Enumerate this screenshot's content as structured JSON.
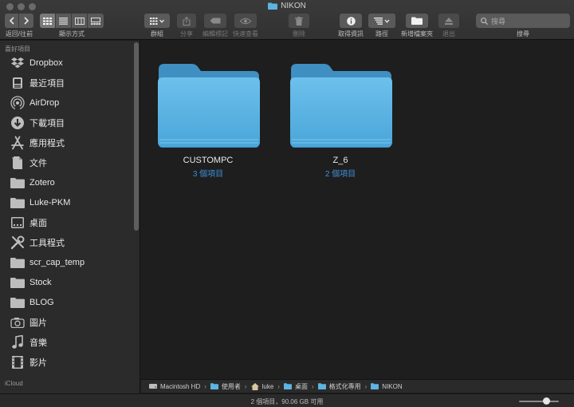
{
  "window": {
    "title": "NIKON"
  },
  "toolbar": {
    "nav_label": "返回/往前",
    "view_label": "顯示方式",
    "group_label": "群組",
    "share_label": "分享",
    "tags_label": "編輯標記",
    "quicklook_label": "快速查看",
    "delete_label": "刪除",
    "info_label": "取得資訊",
    "path_label": "路徑",
    "new_folder_label": "新增檔案夾",
    "eject_label": "退出",
    "search_label": "搜尋",
    "search_placeholder": "搜尋"
  },
  "sidebar": {
    "favorites_header": "喜好項目",
    "items": [
      {
        "label": "Dropbox",
        "icon": "dropbox-icon"
      },
      {
        "label": "最近項目",
        "icon": "recents-icon"
      },
      {
        "label": "AirDrop",
        "icon": "airdrop-icon"
      },
      {
        "label": "下載項目",
        "icon": "downloads-icon"
      },
      {
        "label": "應用程式",
        "icon": "applications-icon"
      },
      {
        "label": "文件",
        "icon": "documents-icon"
      },
      {
        "label": "Zotero",
        "icon": "folder-icon"
      },
      {
        "label": "Luke-PKM",
        "icon": "folder-icon"
      },
      {
        "label": "桌面",
        "icon": "desktop-icon"
      },
      {
        "label": "工具程式",
        "icon": "utilities-icon"
      },
      {
        "label": "scr_cap_temp",
        "icon": "folder-icon"
      },
      {
        "label": "Stock",
        "icon": "folder-icon"
      },
      {
        "label": "BLOG",
        "icon": "folder-icon"
      },
      {
        "label": "圖片",
        "icon": "pictures-icon"
      },
      {
        "label": "音樂",
        "icon": "music-icon"
      },
      {
        "label": "影片",
        "icon": "movies-icon"
      }
    ],
    "icloud_header": "iCloud"
  },
  "files": [
    {
      "name": "CUSTOMPC",
      "count": "3 個項目"
    },
    {
      "name": "Z_6",
      "count": "2 個項目"
    }
  ],
  "pathbar": {
    "crumbs": [
      "Macintosh HD",
      "使用者",
      "luke",
      "桌面",
      "格式化專用",
      "NIKON"
    ]
  },
  "status": {
    "text": "2 個項目，90.06 GB 可用"
  },
  "colors": {
    "folder": "#5db4e2",
    "accent": "#3f8fd8"
  }
}
